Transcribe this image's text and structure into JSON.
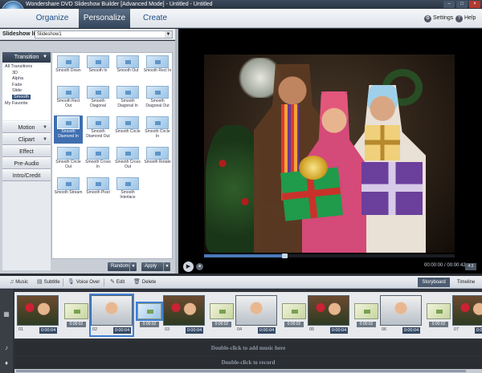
{
  "window": {
    "title": "Wondershare DVD Slideshow Builder [Advanced Mode] - Untitled - Untitled",
    "min": "–",
    "max": "□",
    "close": "×"
  },
  "nav": {
    "organize": "Organize",
    "personalize": "Personalize",
    "create": "Create",
    "settings": "Settings",
    "help": "Help",
    "settings_icon": "⚙",
    "help_icon": "?"
  },
  "slideshow": {
    "label": "Slideshow list:",
    "value": "Slideshow1"
  },
  "categories": {
    "transition": "Transition",
    "tree": [
      "All Transitions",
      "3D",
      "Alpha",
      "Fade",
      "Slide",
      "Smooth",
      "My Favorite"
    ],
    "motion": "Motion",
    "clipart": "Clipart",
    "effect": "Effect",
    "preaudio": "Pre-Audio",
    "introcredit": "Intro/Credit"
  },
  "transitions": [
    "Smooth Down",
    "Smooth In",
    "Smooth Out",
    "Smooth Rect In",
    "Smooth Rect Out",
    "Smooth Diagonal",
    "Smooth Diagonal In",
    "Smooth Diagonal Out",
    "Smooth Diamond In",
    "Smooth Diamond Out",
    "Smooth Circle",
    "Smooth Circle In",
    "Smooth Circle Out",
    "Smooth Cross In",
    "Smooth Cross Out",
    "Smooth Rotate",
    "Smooth Stream",
    "Smooth Pixel",
    "Smooth Interlace"
  ],
  "grid_buttons": {
    "random": "Random",
    "apply": "Apply"
  },
  "player": {
    "timecode": "00:00:00 / 00:00:42",
    "progress": 0.32,
    "play": "▶",
    "stop": "■",
    "full": "4:3"
  },
  "toolbar": {
    "music": "Music",
    "subtitle": "Subtitle",
    "voiceover": "Voice Over",
    "edit": "Edit",
    "delete": "Delete",
    "storyboard": "Storyboard",
    "timeline": "Timeline"
  },
  "tracks": {
    "music_hint": "Double-click to add music here",
    "record_hint": "Double-click to record"
  },
  "clips": [
    {
      "num": "01",
      "dur": "0:00:04"
    },
    {
      "num": "02",
      "dur": "0:00:04"
    },
    {
      "num": "03",
      "dur": "0:00:04"
    },
    {
      "num": "04",
      "dur": "0:00:04"
    },
    {
      "num": "05",
      "dur": "0:00:04"
    },
    {
      "num": "06",
      "dur": "0:00:04"
    },
    {
      "num": "07",
      "dur": "0:00:04"
    }
  ],
  "transitions_dur": "0:00:02"
}
